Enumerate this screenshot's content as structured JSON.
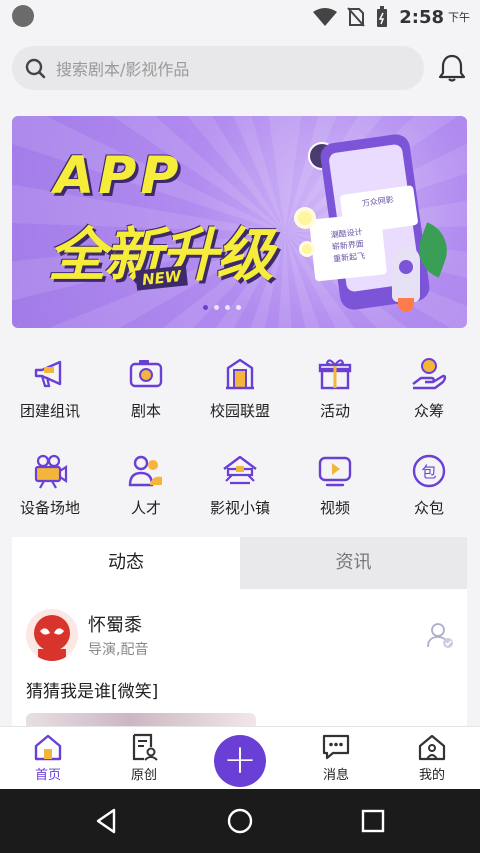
{
  "status_bar": {
    "time": "2:58",
    "ampm": "下午"
  },
  "search": {
    "placeholder": "搜索剧本/影视作品"
  },
  "banner": {
    "headline": "APP",
    "main_text": "全新升级",
    "tag": "NEW",
    "card_title": "万众网影",
    "card_lines": [
      "潮酷设计",
      "崭新界面",
      "重新起飞"
    ],
    "page_count": 4,
    "active_page": 1
  },
  "categories": [
    {
      "label": "团建组讯",
      "icon": "megaphone-icon"
    },
    {
      "label": "剧本",
      "icon": "camera-icon"
    },
    {
      "label": "校园联盟",
      "icon": "building-icon"
    },
    {
      "label": "活动",
      "icon": "gift-icon"
    },
    {
      "label": "众筹",
      "icon": "coin-hand-icon"
    },
    {
      "label": "设备场地",
      "icon": "video-camera-icon"
    },
    {
      "label": "人才",
      "icon": "people-icon"
    },
    {
      "label": "影视小镇",
      "icon": "town-icon"
    },
    {
      "label": "视频",
      "icon": "play-icon"
    },
    {
      "label": "众包",
      "icon": "bag-icon"
    }
  ],
  "tabs": [
    {
      "label": "动态",
      "active": true
    },
    {
      "label": "资讯",
      "active": false
    }
  ],
  "post": {
    "author": "怀蜀黍",
    "roles": "导演,配音",
    "text": "猜猜我是谁[微笑]"
  },
  "bottom_nav": [
    {
      "label": "首页",
      "icon": "home-icon",
      "active": true
    },
    {
      "label": "原创",
      "icon": "document-icon",
      "active": false
    },
    {
      "label": "消息",
      "icon": "message-icon",
      "active": false
    },
    {
      "label": "我的",
      "icon": "house-user-icon",
      "active": false
    }
  ],
  "colors": {
    "accent": "#6a3fd6",
    "icon_purple": "#6a3fd6",
    "banner_yellow": "#f6ec3a"
  }
}
